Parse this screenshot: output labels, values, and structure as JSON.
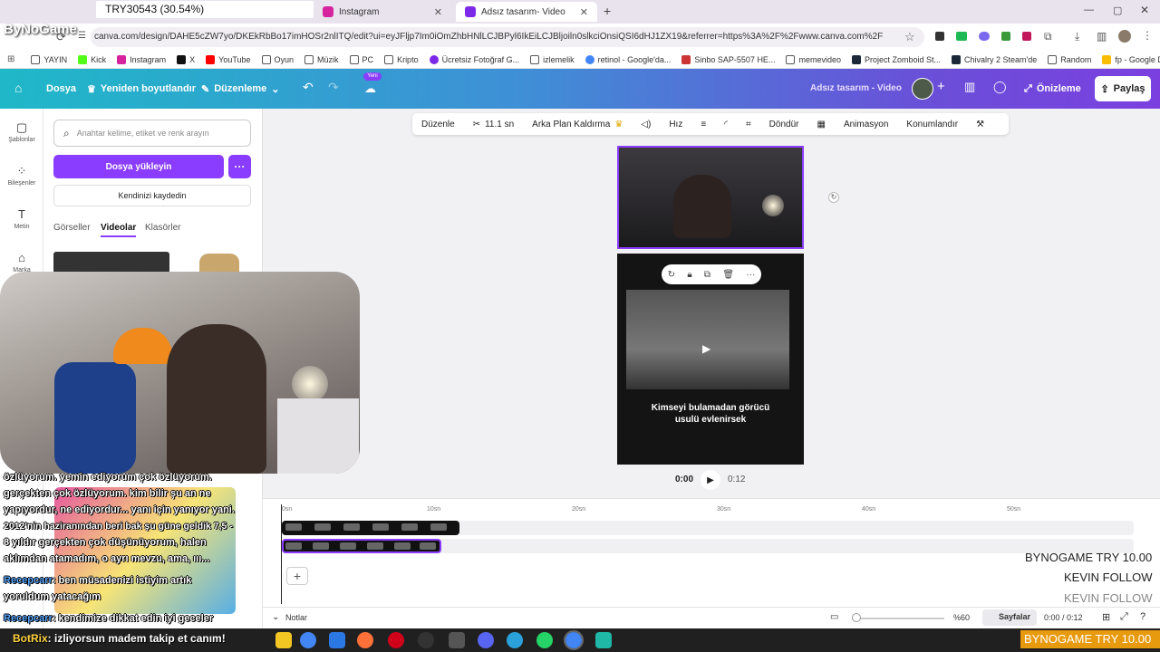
{
  "overlay": {
    "counter_pill": "TRY30543 (30.54%)",
    "logo": "ByNoGame"
  },
  "browser": {
    "tabs": [
      {
        "label": "Instagram",
        "color": "#d6249f"
      },
      {
        "label": "Adsız tasarım- Video",
        "color": "#7d2ae8"
      }
    ],
    "url": "canva.com/design/DAHE5cZW7yo/DKEkRbBo17imHOSr2nlITQ/edit?ui=eyJFljp7Im0iOmZhbHNlLCJBPyl6IkEiLCJBljoiln0slkciOnsiQSI6dHJ1ZX19&referrer=https%3A%2F%2Fwww.canva.com%2F",
    "bookmarks": [
      "YAYIN",
      "Kick",
      "Instagram",
      "X",
      "YouTube",
      "Oyun",
      "Müzik",
      "PC",
      "Kripto",
      "Ücretsiz Fotoğraf G...",
      "izlemelik",
      "retinol - Google'da...",
      "Sinbo SAP-5507 HE...",
      "memevideo",
      "Project Zomboid St...",
      "Chivalry 2 Steam'de",
      "Random",
      "fp - Google Drive"
    ]
  },
  "canva": {
    "file_menu": "Dosya",
    "resize": "Yeniden boyutlandır",
    "edit": "Düzenleme",
    "new_badge": "Yeni",
    "doc_title": "Adsız tasarım - Video",
    "preview": "Önizleme",
    "share": "Paylaş"
  },
  "rail": [
    {
      "label": "Şablonlar",
      "icon": "layout-icon"
    },
    {
      "label": "Bileşenler",
      "icon": "elements-icon"
    },
    {
      "label": "Metin",
      "icon": "text-icon"
    },
    {
      "label": "Marka",
      "icon": "brand-icon"
    }
  ],
  "panel": {
    "search_placeholder": "Anahtar kelime, etiket ve renk arayın",
    "upload": "Dosya yükleyin",
    "record": "Kendinizi kaydedin",
    "tabs": [
      "Görseller",
      "Videolar",
      "Klasörler"
    ]
  },
  "toolbar": {
    "edit": "Düzenle",
    "duration": "11.1 sn",
    "bg_remove": "Arka Plan Kaldırma",
    "speed": "Hız",
    "rotate": "Döndür",
    "animation": "Animasyon",
    "position": "Konumlandır"
  },
  "video": {
    "subtitle_1": "Kimseyi bulamadan görücü",
    "subtitle_2": "usulü evlenirsek"
  },
  "playback": {
    "current": "0:00",
    "total": "0:12"
  },
  "timeline": {
    "ticks": [
      "0sn",
      "10sn",
      "20sn",
      "30sn",
      "40sn",
      "50sn"
    ]
  },
  "bottom": {
    "notes": "Notlar",
    "zoom": "%60",
    "pages": "Sayfalar",
    "time": "0:00 / 0:12"
  },
  "chat": {
    "lines": [
      "özlüyorum. yemin ediyorum çok özlüyorum.",
      "gerçekten çok özlüyorum. kim bilir şu an ne",
      "yapıyordur, ne ediyordur... yanı için yanıyor yani.",
      "2012'nin haziranından beri bak şu güne geldik 7,5 -",
      "8 yıldır gerçekten çok düşünüyorum, halen",
      "aklımdan atamadım, o ayrı mevzu, ama, ııı..."
    ],
    "user1": "Recepcarr",
    "msg1": ": ben müsadenizi istiyim artık",
    "msg1b": "yoruldum yatacağım",
    "user2": "Recepcarr",
    "msg2": ": kendimize dikkat edin iyi geceler",
    "bot": "BotRix",
    "botmsg": ": izliyorsun madem takip et canım!"
  },
  "stream": {
    "line1": "BYNOGAME  TRY 10.00",
    "line2": "KEVIN  FOLLOW",
    "line3": "KEVIN  FOLLOW",
    "ticker": "BYNOGAME  TRY 10.00"
  }
}
